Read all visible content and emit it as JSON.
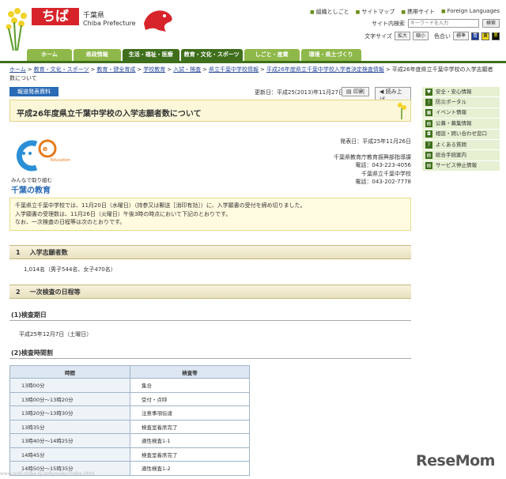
{
  "header": {
    "logo_text": "ちば",
    "brand_jp": "千葉県",
    "brand_en": "Chiba Prefecture",
    "top_links": [
      "組織としごと",
      "サイトマップ",
      "携帯サイト",
      "Foreign Languages"
    ],
    "search_label": "サイト内検索",
    "search_placeholder": "キーワードを入力",
    "search_button": "検索",
    "font_size_label": "文字サイズ",
    "enlarge": "拡大",
    "shrink": "縮小",
    "color_label": "色合い",
    "standard": "標準",
    "color_options": [
      "青",
      "黄",
      "黒"
    ]
  },
  "nav": {
    "items": [
      "ホーム",
      "県政情報",
      "生活・福祉・医療",
      "教育・文化・スポーツ",
      "しごと・産業",
      "環境・県土づくり"
    ]
  },
  "breadcrumb": {
    "items": [
      "ホーム",
      "教育・文化・スポーツ",
      "教育・健全育成",
      "学校教育",
      "入試・検査",
      "県立千葉中学校情報",
      "平成26年度県立千葉中学校入学者決定検査情報"
    ],
    "current": "平成26年度県立千葉中学校の入学志願者数について",
    "separator": ">"
  },
  "main": {
    "tag": "報道発表資料",
    "updated": "更新日：平成25(2013)年11月27日",
    "print": "印刷",
    "read_aloud": "読み上げ",
    "title": "平成26年度県立千葉中学校の入学志願者数について",
    "edu_logo_caption1": "みんなで取り組む",
    "edu_logo_caption2": "千葉の教育",
    "edu_logo_mark": "Education",
    "published": "発表日：平成25年11月26日",
    "office": "千葉県教育庁教育振興部指導課",
    "phone1": "電話：043-223-4056",
    "school": "千葉県立千葉中学校",
    "phone2": "電話：043-202-7778",
    "notice": [
      "千葉県立千葉中学校では、11月20日（水曜日）（持参又は郵送［消印有効］）に、入学願書の受付を締め切りました。",
      "入学願書の受理数は、11月26日（火曜日）午後3時の時点において下記のとおりです。",
      "なお、一次検査の日程等は次のとおりです。"
    ],
    "section1_num": "1",
    "section1_title": "入学志願者数",
    "applicants": "1,014名（男子544名、女子470名）",
    "section2_num": "2",
    "section2_title": "一次検査の日程等",
    "sub1": "(1)検査期日",
    "exam_date": "平成25年12月7日（土曜日）",
    "sub2": "(2)検査時間割",
    "table_headers": [
      "時間",
      "検査等"
    ],
    "table_rows": [
      [
        "13時00分",
        "集合"
      ],
      [
        "13時00分～13時20分",
        "受付・点呼"
      ],
      [
        "13時20分～13時30分",
        "注意事項伝達"
      ],
      [
        "13時35分",
        "検査室着席完了"
      ],
      [
        "13時40分～14時25分",
        "適性検査1-1"
      ],
      [
        "14時45分",
        "検査室着席完了"
      ],
      [
        "14時50分～15時35分",
        "適性検査1-2"
      ]
    ]
  },
  "sidebar": {
    "items": [
      {
        "label": "安全・安心情報",
        "icon": "heart"
      },
      {
        "label": "防災ポータル",
        "icon": "alert"
      },
      {
        "label": "イベント情報",
        "icon": "calendar"
      },
      {
        "label": "公募・募集情報",
        "icon": "document"
      },
      {
        "label": "相談・問い合わせ窓口",
        "icon": "chat"
      },
      {
        "label": "よくある質問",
        "icon": "question"
      },
      {
        "label": "総合手続案内",
        "icon": "document"
      },
      {
        "label": "サービス停止情報",
        "icon": "document"
      }
    ]
  },
  "watermark": "ReseMom",
  "status_url": "www.pref.chiba.lg.jp/kyouiku/index.html"
}
